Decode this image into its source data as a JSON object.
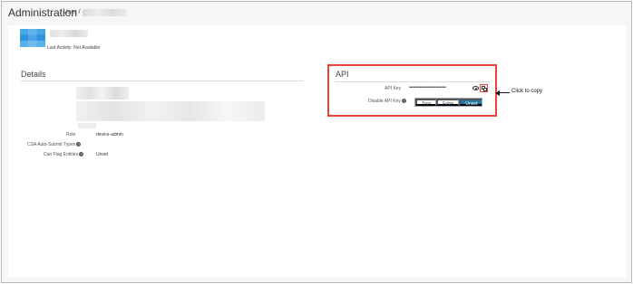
{
  "breadcrumb": {
    "title": "Administration",
    "rest": "/ User /"
  },
  "user": {
    "last_activity": "Last Activity: Not Available"
  },
  "details": {
    "title": "Details",
    "fields": [
      {
        "label": "Role",
        "value": "device-admin"
      },
      {
        "label": "CSA Auto-Submit Types",
        "value": ""
      },
      {
        "label": "Can Flag Entities",
        "value": "Unset"
      }
    ]
  },
  "api": {
    "title": "API",
    "key_label": "API Key",
    "key_value": "••••••••••••••••••••••••••••",
    "disable_label": "Disable API Key",
    "disable_options": [
      "True",
      "False",
      "Unset"
    ],
    "disable_selected": "Unset"
  },
  "annotation": {
    "callout": "Click to copy"
  },
  "colors": {
    "highlight": "#e9443a",
    "selected_segment": "#1b7aa6"
  }
}
